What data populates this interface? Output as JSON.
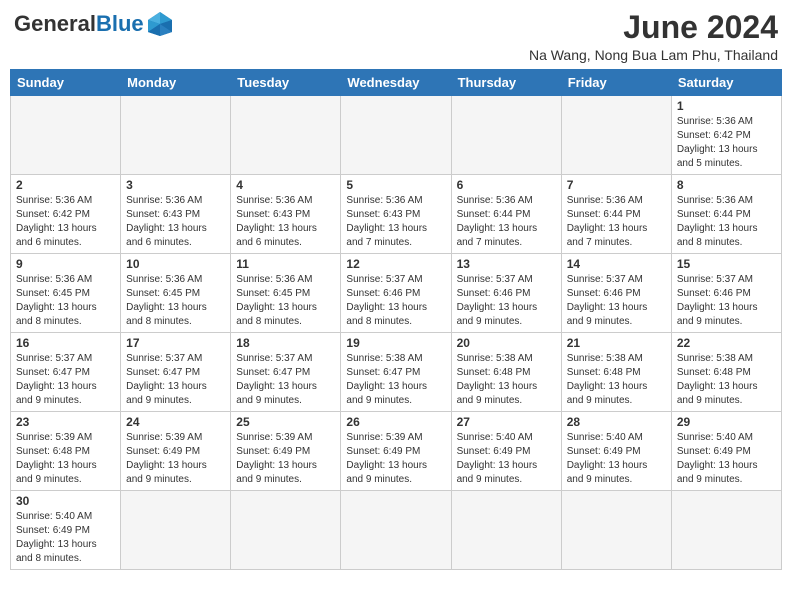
{
  "header": {
    "logo_general": "General",
    "logo_blue": "Blue",
    "month_title": "June 2024",
    "location": "Na Wang, Nong Bua Lam Phu, Thailand"
  },
  "weekdays": [
    "Sunday",
    "Monday",
    "Tuesday",
    "Wednesday",
    "Thursday",
    "Friday",
    "Saturday"
  ],
  "weeks": [
    [
      {
        "day": "",
        "info": ""
      },
      {
        "day": "",
        "info": ""
      },
      {
        "day": "",
        "info": ""
      },
      {
        "day": "",
        "info": ""
      },
      {
        "day": "",
        "info": ""
      },
      {
        "day": "",
        "info": ""
      },
      {
        "day": "1",
        "info": "Sunrise: 5:36 AM\nSunset: 6:42 PM\nDaylight: 13 hours and 5 minutes."
      }
    ],
    [
      {
        "day": "2",
        "info": "Sunrise: 5:36 AM\nSunset: 6:42 PM\nDaylight: 13 hours and 6 minutes."
      },
      {
        "day": "3",
        "info": "Sunrise: 5:36 AM\nSunset: 6:43 PM\nDaylight: 13 hours and 6 minutes."
      },
      {
        "day": "4",
        "info": "Sunrise: 5:36 AM\nSunset: 6:43 PM\nDaylight: 13 hours and 6 minutes."
      },
      {
        "day": "5",
        "info": "Sunrise: 5:36 AM\nSunset: 6:43 PM\nDaylight: 13 hours and 7 minutes."
      },
      {
        "day": "6",
        "info": "Sunrise: 5:36 AM\nSunset: 6:44 PM\nDaylight: 13 hours and 7 minutes."
      },
      {
        "day": "7",
        "info": "Sunrise: 5:36 AM\nSunset: 6:44 PM\nDaylight: 13 hours and 7 minutes."
      },
      {
        "day": "8",
        "info": "Sunrise: 5:36 AM\nSunset: 6:44 PM\nDaylight: 13 hours and 8 minutes."
      }
    ],
    [
      {
        "day": "9",
        "info": "Sunrise: 5:36 AM\nSunset: 6:45 PM\nDaylight: 13 hours and 8 minutes."
      },
      {
        "day": "10",
        "info": "Sunrise: 5:36 AM\nSunset: 6:45 PM\nDaylight: 13 hours and 8 minutes."
      },
      {
        "day": "11",
        "info": "Sunrise: 5:36 AM\nSunset: 6:45 PM\nDaylight: 13 hours and 8 minutes."
      },
      {
        "day": "12",
        "info": "Sunrise: 5:37 AM\nSunset: 6:46 PM\nDaylight: 13 hours and 8 minutes."
      },
      {
        "day": "13",
        "info": "Sunrise: 5:37 AM\nSunset: 6:46 PM\nDaylight: 13 hours and 9 minutes."
      },
      {
        "day": "14",
        "info": "Sunrise: 5:37 AM\nSunset: 6:46 PM\nDaylight: 13 hours and 9 minutes."
      },
      {
        "day": "15",
        "info": "Sunrise: 5:37 AM\nSunset: 6:46 PM\nDaylight: 13 hours and 9 minutes."
      }
    ],
    [
      {
        "day": "16",
        "info": "Sunrise: 5:37 AM\nSunset: 6:47 PM\nDaylight: 13 hours and 9 minutes."
      },
      {
        "day": "17",
        "info": "Sunrise: 5:37 AM\nSunset: 6:47 PM\nDaylight: 13 hours and 9 minutes."
      },
      {
        "day": "18",
        "info": "Sunrise: 5:37 AM\nSunset: 6:47 PM\nDaylight: 13 hours and 9 minutes."
      },
      {
        "day": "19",
        "info": "Sunrise: 5:38 AM\nSunset: 6:47 PM\nDaylight: 13 hours and 9 minutes."
      },
      {
        "day": "20",
        "info": "Sunrise: 5:38 AM\nSunset: 6:48 PM\nDaylight: 13 hours and 9 minutes."
      },
      {
        "day": "21",
        "info": "Sunrise: 5:38 AM\nSunset: 6:48 PM\nDaylight: 13 hours and 9 minutes."
      },
      {
        "day": "22",
        "info": "Sunrise: 5:38 AM\nSunset: 6:48 PM\nDaylight: 13 hours and 9 minutes."
      }
    ],
    [
      {
        "day": "23",
        "info": "Sunrise: 5:39 AM\nSunset: 6:48 PM\nDaylight: 13 hours and 9 minutes."
      },
      {
        "day": "24",
        "info": "Sunrise: 5:39 AM\nSunset: 6:49 PM\nDaylight: 13 hours and 9 minutes."
      },
      {
        "day": "25",
        "info": "Sunrise: 5:39 AM\nSunset: 6:49 PM\nDaylight: 13 hours and 9 minutes."
      },
      {
        "day": "26",
        "info": "Sunrise: 5:39 AM\nSunset: 6:49 PM\nDaylight: 13 hours and 9 minutes."
      },
      {
        "day": "27",
        "info": "Sunrise: 5:40 AM\nSunset: 6:49 PM\nDaylight: 13 hours and 9 minutes."
      },
      {
        "day": "28",
        "info": "Sunrise: 5:40 AM\nSunset: 6:49 PM\nDaylight: 13 hours and 9 minutes."
      },
      {
        "day": "29",
        "info": "Sunrise: 5:40 AM\nSunset: 6:49 PM\nDaylight: 13 hours and 9 minutes."
      }
    ],
    [
      {
        "day": "30",
        "info": "Sunrise: 5:40 AM\nSunset: 6:49 PM\nDaylight: 13 hours and 8 minutes."
      },
      {
        "day": "",
        "info": ""
      },
      {
        "day": "",
        "info": ""
      },
      {
        "day": "",
        "info": ""
      },
      {
        "day": "",
        "info": ""
      },
      {
        "day": "",
        "info": ""
      },
      {
        "day": "",
        "info": ""
      }
    ]
  ]
}
